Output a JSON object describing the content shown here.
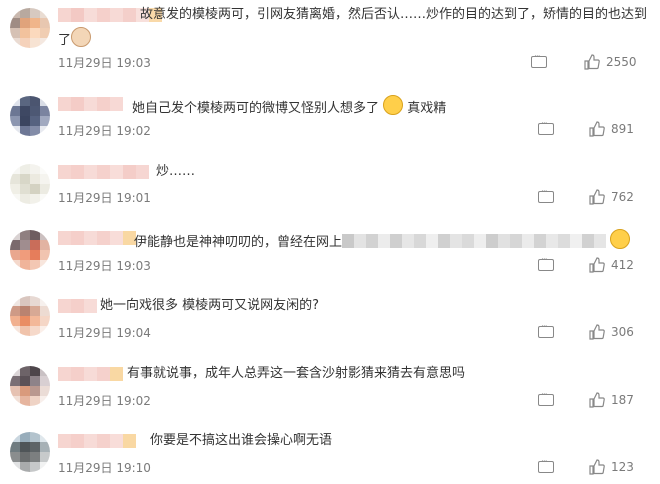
{
  "comments": [
    {
      "text_a": "故意发的模棱两可，引网友猜离婚，然后否认……炒作的目的达到了，矫情的目的也达到",
      "text_b": "了",
      "time": "11月29日 19:03",
      "likes": "2550"
    },
    {
      "text": "她自己发个模棱两可的微博又怪别人想多了",
      "text_after": "真戏精",
      "time": "11月29日 19:02",
      "likes": "891"
    },
    {
      "text": "炒……",
      "time": "11月29日 19:01",
      "likes": "762"
    },
    {
      "text": "伊能静也是神神叨叨的，曾经在网上",
      "time": "11月29日 19:03",
      "likes": "412"
    },
    {
      "text": "她一向戏很多 模棱两可又说网友闲的?",
      "time": "11月29日 19:04",
      "likes": "306"
    },
    {
      "text": "有事就说事，成年人总弄这一套含沙射影猜来猜去有意思吗",
      "time": "11月29日 19:02",
      "likes": "187"
    },
    {
      "text": "你要是不搞这出谁会操心啊无语",
      "time": "11月29日 19:10",
      "likes": "123"
    }
  ],
  "icons": [
    "reply-icon",
    "thumbs-up-icon",
    "cat-emoji-icon",
    "grimace-emoji-icon",
    "laugh-cry-emoji-icon"
  ]
}
